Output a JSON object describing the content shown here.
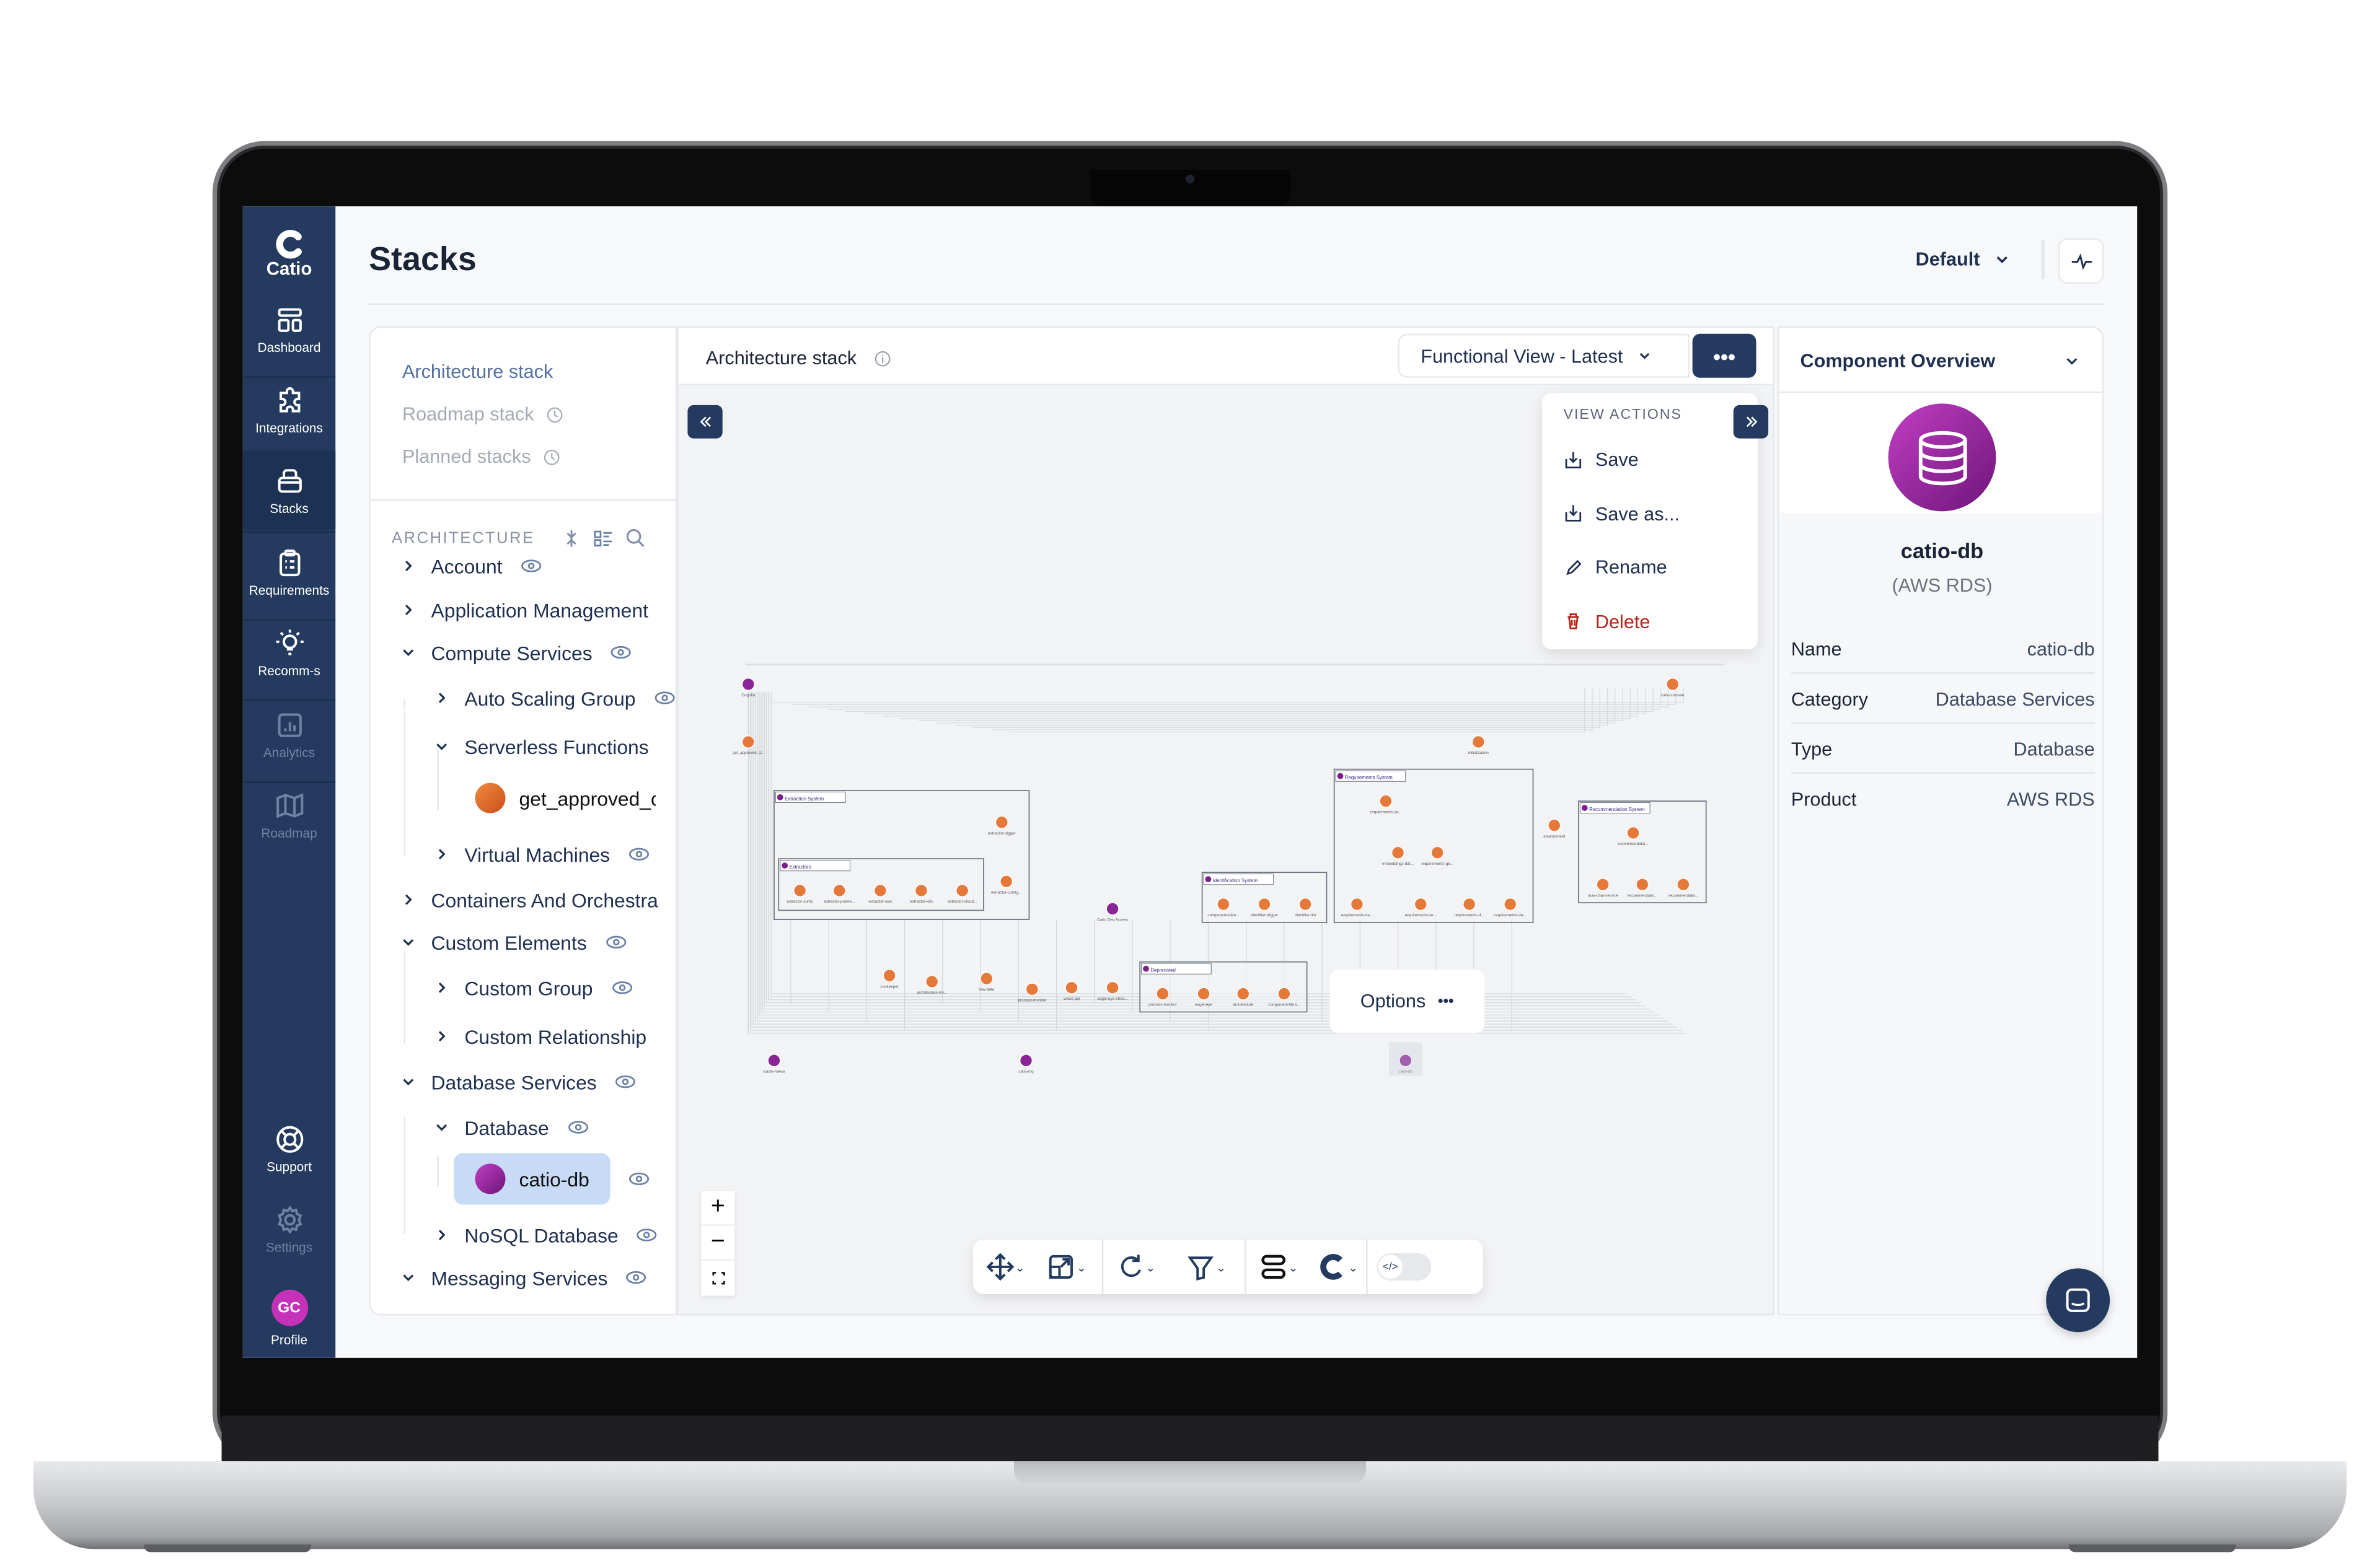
{
  "app": {
    "logo_text": "Catio",
    "page_title": "Stacks"
  },
  "sidebar": {
    "items": [
      {
        "label": "Dashboard",
        "icon": "dashboard-icon",
        "state": "normal"
      },
      {
        "label": "Integrations",
        "icon": "puzzle-icon",
        "state": "normal"
      },
      {
        "label": "Stacks",
        "icon": "stacks-icon",
        "state": "active"
      },
      {
        "label": "Requirements",
        "icon": "clipboard-icon",
        "state": "normal"
      },
      {
        "label": "Recomm-s",
        "icon": "lightbulb-icon",
        "state": "normal"
      },
      {
        "label": "Analytics",
        "icon": "chart-icon",
        "state": "disabled"
      },
      {
        "label": "Roadmap",
        "icon": "map-icon",
        "state": "disabled"
      }
    ],
    "bottom_items": [
      {
        "label": "Support",
        "icon": "lifebuoy-icon",
        "state": "normal"
      },
      {
        "label": "Settings",
        "icon": "gear-icon",
        "state": "disabled"
      }
    ],
    "profile": {
      "initials": "GC",
      "label": "Profile",
      "color": "#c531b9"
    }
  },
  "header": {
    "view_selector": "Default"
  },
  "stacks_nav": [
    {
      "label": "Architecture stack",
      "state": "active",
      "clock": false
    },
    {
      "label": "Roadmap stack",
      "state": "disabled",
      "clock": true
    },
    {
      "label": "Planned stacks",
      "state": "disabled",
      "clock": true
    }
  ],
  "tree": {
    "heading": "ARCHITECTURE",
    "items": [
      {
        "label": "Account",
        "level": 1,
        "chevron": "right",
        "eye": true
      },
      {
        "label": "Application Management",
        "level": 1,
        "chevron": "right",
        "eye": false
      },
      {
        "label": "Compute Services",
        "level": 1,
        "chevron": "down",
        "eye": true
      },
      {
        "label": "Auto Scaling Group",
        "level": 2,
        "chevron": "right",
        "eye": true
      },
      {
        "label": "Serverless Functions",
        "level": 2,
        "chevron": "down",
        "eye": false
      },
      {
        "label": "get_approved_c",
        "level": 3,
        "icon": "lambda-icon",
        "eye": false
      },
      {
        "label": "Virtual Machines",
        "level": 2,
        "chevron": "right",
        "eye": true
      },
      {
        "label": "Containers And Orchestra",
        "level": 1,
        "chevron": "right",
        "eye": false
      },
      {
        "label": "Custom Elements",
        "level": 1,
        "chevron": "down",
        "eye": true
      },
      {
        "label": "Custom Group",
        "level": 2,
        "chevron": "right",
        "eye": true
      },
      {
        "label": "Custom Relationship",
        "level": 2,
        "chevron": "right",
        "eye": false
      },
      {
        "label": "Database Services",
        "level": 1,
        "chevron": "down",
        "eye": true
      },
      {
        "label": "Database",
        "level": 2,
        "chevron": "down",
        "eye": true
      },
      {
        "label": "catio-db",
        "level": 3,
        "icon": "database-icon",
        "eye": true,
        "selected": true
      },
      {
        "label": "NoSQL Database",
        "level": 2,
        "chevron": "right",
        "eye": true
      },
      {
        "label": "Messaging Services",
        "level": 1,
        "chevron": "down",
        "eye": true
      }
    ]
  },
  "canvas": {
    "title": "Architecture stack",
    "view": "Functional View - Latest",
    "menu": {
      "heading": "VIEW ACTIONS",
      "items": [
        {
          "label": "Save",
          "icon": "save-icon",
          "danger": false
        },
        {
          "label": "Save as...",
          "icon": "save-as-icon",
          "danger": false
        },
        {
          "label": "Rename",
          "icon": "pencil-icon",
          "danger": false
        },
        {
          "label": "Delete",
          "icon": "trash-icon",
          "danger": true
        }
      ]
    },
    "options_label": "Options",
    "diagram": {
      "groups": [
        "Extraction System",
        "Extractors",
        "Identification System",
        "Requirements System",
        "Recommendation System",
        "Deprecated"
      ],
      "nodes": [
        "Cognito",
        "catio-console",
        "get_approved_d...",
        "initialization",
        "extractor-trigger",
        "extractor-config...",
        "extractor-sumo",
        "extractor-prome...",
        "extractor-aws",
        "extractor-k8s",
        "extractor-cloud...",
        "Catio Dev Access",
        "component-iden...",
        "identifier-trigger",
        "identifier-llm",
        "requirements-pr...",
        "embeddings-dat...",
        "requirements-ge...",
        "requirements-da...",
        "requirements-se...",
        "requirements-d...",
        "requirements-da...",
        "environment",
        "recommendatio...",
        "max-chat-service",
        "recommendatio...",
        "recommendatio...",
        "zookeeper",
        "architecture-inv...",
        "raw-data",
        "process-monitor",
        "views-api",
        "eagle-eye-strea...",
        "process-monitor",
        "eagle-eye",
        "architecture",
        "component-libra...",
        "stacks-views",
        "catio-mq",
        "catio-db"
      ]
    },
    "toolbar": [
      "move-icon",
      "layout-icon",
      "refresh-icon",
      "filter-icon",
      "group-icon",
      "catio-logo-icon",
      "code-toggle-icon"
    ]
  },
  "overview": {
    "title": "Component Overview",
    "name": "catio-db",
    "product_label": "(AWS RDS)",
    "icon_color": "#a32bb0",
    "rows": [
      {
        "k": "Name",
        "v": "catio-db"
      },
      {
        "k": "Category",
        "v": "Database Services"
      },
      {
        "k": "Type",
        "v": "Database"
      },
      {
        "k": "Product",
        "v": "AWS RDS"
      }
    ]
  }
}
